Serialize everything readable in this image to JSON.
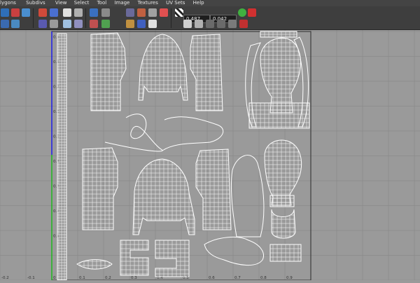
{
  "menu": [
    "lygons",
    "Subdivs",
    "View",
    "Select",
    "Tool",
    "Image",
    "Textures",
    "UV Sets",
    "Help"
  ],
  "toolbar": {
    "u_value": "0.487",
    "v_value": "0.042",
    "icons": [
      "uv-snapshot-icon",
      "isolate-icon",
      "grid-toggle-icon",
      "pixel-snap-icon",
      "checker-icon",
      "flip-u-icon",
      "flip-v-icon",
      "rotate-icon",
      "layout-icon",
      "copy-uv-icon",
      "paste-uv-icon",
      "cycle-uv-icon",
      "image-range-icon"
    ]
  },
  "grid": {
    "x_ticks": [
      "-0.2",
      "-0.1",
      "0",
      "0.1",
      "0.2",
      "0.3",
      "0.4",
      "0.5",
      "0.6",
      "0.7",
      "0.8",
      "0.9"
    ],
    "y_ticks": [
      "0.9",
      "0.8",
      "0.7",
      "0.6",
      "0.5",
      "0.4",
      "0.3",
      "0.2",
      "0.1"
    ],
    "u_axis_color": "#00c000",
    "v_axis_color": "#0000ff"
  }
}
